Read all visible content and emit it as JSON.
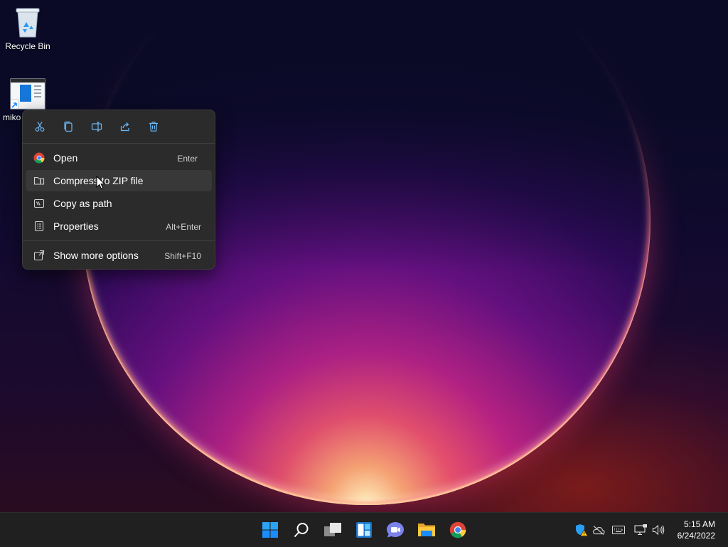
{
  "desktop": {
    "icons": [
      {
        "name": "recycle-bin",
        "label": "Recycle Bin"
      },
      {
        "name": "shortcut-file",
        "label": "miko"
      }
    ]
  },
  "context_menu": {
    "quick_actions": [
      {
        "name": "cut-icon",
        "title": "Cut"
      },
      {
        "name": "copy-icon",
        "title": "Copy"
      },
      {
        "name": "rename-icon",
        "title": "Rename"
      },
      {
        "name": "share-icon",
        "title": "Share"
      },
      {
        "name": "delete-icon",
        "title": "Delete"
      }
    ],
    "items": [
      {
        "label": "Open",
        "shortcut": "Enter",
        "icon": "chrome-icon"
      },
      {
        "label": "Compress to ZIP file",
        "shortcut": "",
        "icon": "zip-folder-icon"
      },
      {
        "label": "Copy as path",
        "shortcut": "",
        "icon": "path-icon"
      },
      {
        "label": "Properties",
        "shortcut": "Alt+Enter",
        "icon": "properties-icon"
      }
    ],
    "more": {
      "label": "Show more options",
      "shortcut": "Shift+F10",
      "icon": "show-more-icon"
    }
  },
  "taskbar": {
    "apps": [
      "start-icon",
      "search-icon",
      "task-view-icon",
      "widgets-icon",
      "teams-chat-icon",
      "file-explorer-icon",
      "chrome-icon"
    ],
    "tray": [
      "defender-warning-icon",
      "onedrive-icon",
      "keyboard-icon",
      "network-icon",
      "volume-icon"
    ],
    "time": "5:15 AM",
    "date": "6/24/2022"
  },
  "colors": {
    "menu_bg": "#2b2b2b",
    "taskbar_bg": "#202020",
    "accent_blue": "#1a8cff"
  }
}
